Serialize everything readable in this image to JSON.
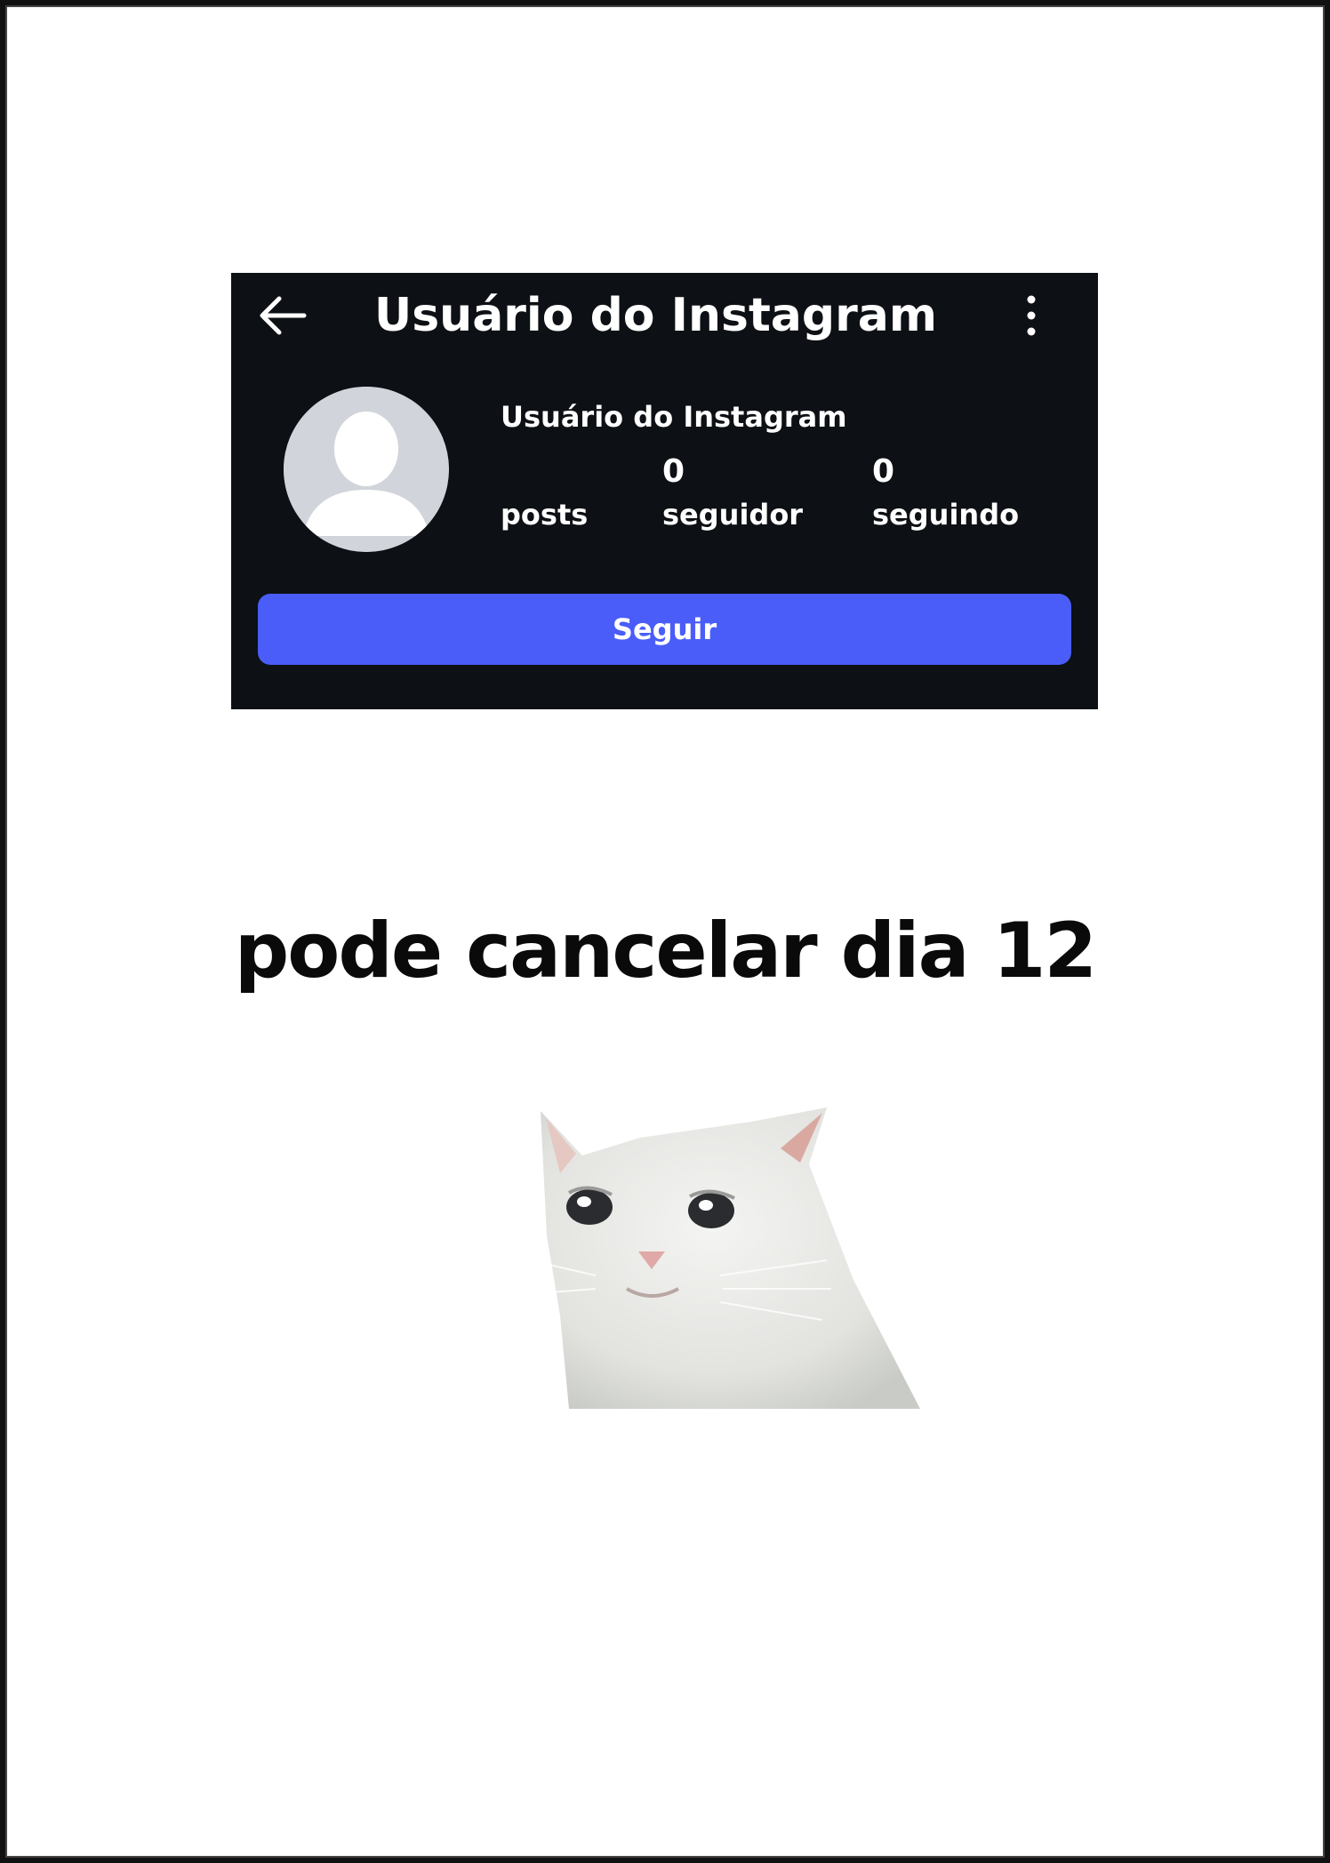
{
  "header": {
    "title": "Usuário do Instagram",
    "back_icon": "arrow-left-icon",
    "more_icon": "more-vertical-icon"
  },
  "profile": {
    "name": "Usuário do Instagram",
    "avatar": "default-avatar-silhouette",
    "stats": {
      "posts": {
        "count": "",
        "label": "posts"
      },
      "followers": {
        "count": "0",
        "label": "seguidor"
      },
      "following": {
        "count": "0",
        "label": "seguindo"
      }
    },
    "follow_button_label": "Seguir"
  },
  "caption": "pode cancelar dia 12",
  "colors": {
    "card_background": "#0d1014",
    "follow_button": "#4a5df9",
    "text_light": "#ffffff",
    "caption_text": "#0a0a0a"
  }
}
